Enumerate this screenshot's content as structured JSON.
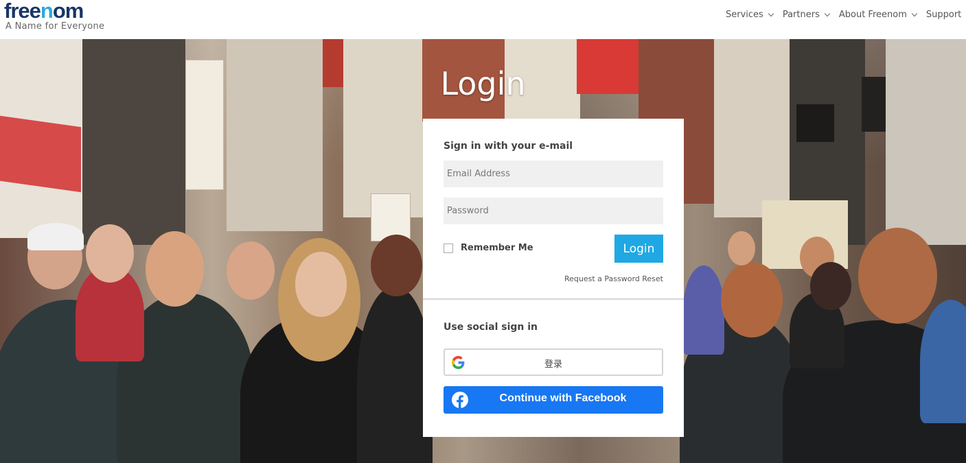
{
  "header": {
    "logo_prefix": "free",
    "logo_accent": "n",
    "logo_suffix": "om",
    "tagline": "A Name for Everyone",
    "nav": [
      "Services",
      "Partners",
      "About Freenom",
      "Support"
    ]
  },
  "hero": {
    "title": "Login",
    "background": "street-crowd-photo"
  },
  "login_card": {
    "email_section_title": "Sign in with your e-mail",
    "email_placeholder": "Email Address",
    "password_placeholder": "Password",
    "remember_label": "Remember Me",
    "login_button": "Login",
    "reset_link": "Request a Password Reset",
    "social_section_title": "Use social sign in",
    "google_button": "登录",
    "facebook_button": "Continue with Facebook"
  },
  "colors": {
    "brand_dark": "#1a3567",
    "brand_accent": "#2aa8e0",
    "login_button": "#1fa8e3",
    "facebook": "#1877f2"
  },
  "icons": {
    "google": "google-g-icon",
    "facebook": "facebook-f-icon",
    "nav_dropdown": "chevron-down-icon"
  }
}
